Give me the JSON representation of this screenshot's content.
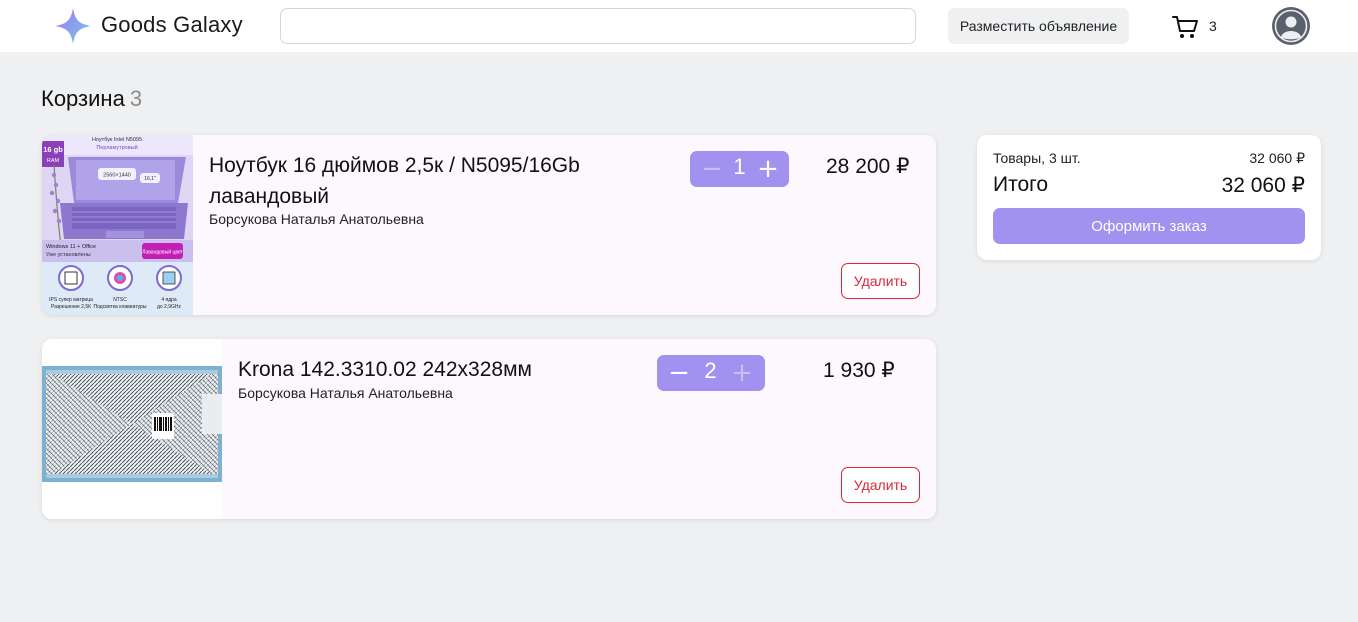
{
  "header": {
    "brand": "Goods Galaxy",
    "search_value": "",
    "post_button": "Разместить объявление",
    "cart_count": "3"
  },
  "page": {
    "title": "Корзина",
    "count": "3"
  },
  "items": [
    {
      "name_line1": "Ноутбук 16 дюймов 2,5к / N5095/16Gb",
      "name_line2": "лавандовый",
      "seller": "Борсукова Наталья Анатольевна",
      "quantity": "1",
      "price": "28 200 ₽",
      "delete_label": "Удалить",
      "image_text": {
        "model": "Ноутбук Intel N5095",
        "color": "Перламутровый",
        "ram": "16 gb",
        "ram_unit": "RAM",
        "resolution": "2560×1440",
        "size": "16,1\"",
        "os": "Windows 11 + Office",
        "os_note": "Уже установлены",
        "badge": "Лавандовый цвет",
        "f1": "IPS супер матрица",
        "f1b": "Разрешение 2,5К",
        "f2": "NTSC",
        "f2b": "Подсветка клавиатуры",
        "f3": "4 ядра",
        "f3b": "до 2,9GHz"
      }
    },
    {
      "name_line1": "Krona 142.3310.02 242x328мм",
      "seller": "Борсукова Наталья Анатольевна",
      "quantity": "2",
      "price": "1 930 ₽",
      "delete_label": "Удалить"
    }
  ],
  "summary": {
    "items_label": "Товары, 3 шт.",
    "items_value": "32 060 ₽",
    "total_label": "Итого",
    "total_value": "32 060 ₽",
    "order_button": "Оформить заказ"
  },
  "stepper": {
    "minus": "−",
    "plus": "+"
  },
  "colors": {
    "accent": "#a092ee",
    "danger": "#d8283a",
    "background": "#eff0f2",
    "card": "#fdf8fe"
  }
}
